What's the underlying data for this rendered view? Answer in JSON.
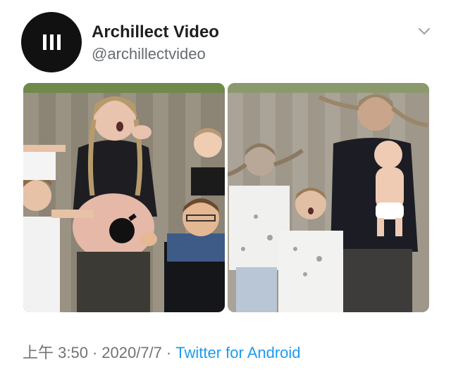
{
  "account": {
    "display_name": "Archillect Video",
    "handle": "@archillectvideo",
    "avatar_icon": "archillect-logo-icon"
  },
  "menu": {
    "icon": "chevron-down-icon"
  },
  "media": [
    {
      "icon": "photo-family-before"
    },
    {
      "icon": "photo-family-after"
    }
  ],
  "meta": {
    "time": "上午 3:50",
    "separator": "·",
    "date": "2020/7/7",
    "source": "Twitter for Android"
  },
  "colors": {
    "text": "#1f1f1f",
    "secondary": "#666b70",
    "link": "#1d9bf0",
    "avatar_bg": "#111111"
  }
}
